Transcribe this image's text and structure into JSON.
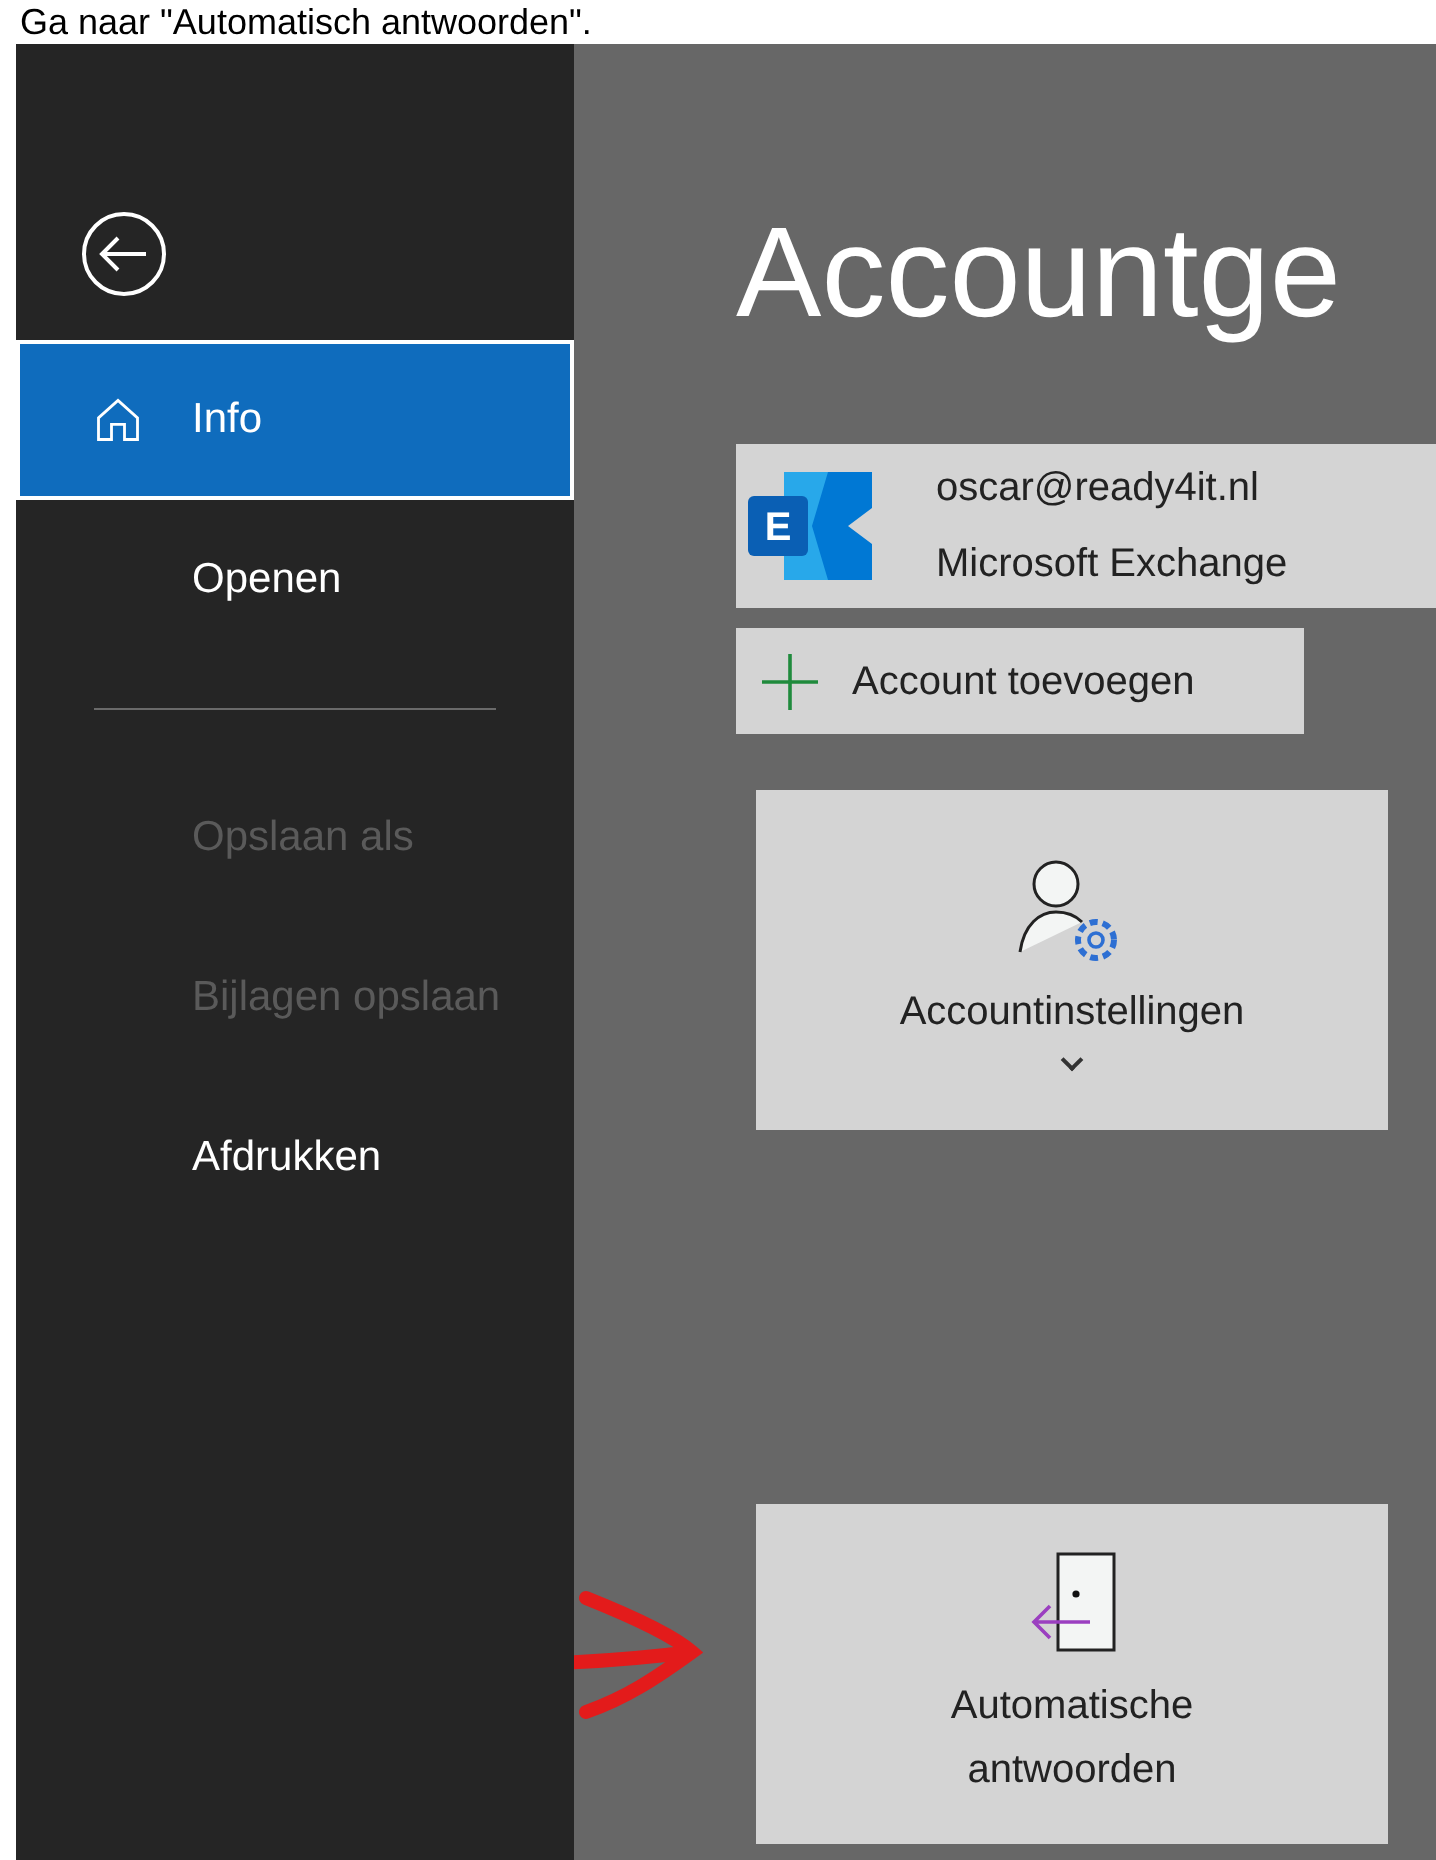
{
  "caption": "Ga naar \"Automatisch antwoorden\".",
  "sidebar": {
    "items": [
      {
        "kind": "home",
        "label": "Info",
        "selected": true,
        "disabled": false
      },
      {
        "kind": "item",
        "label": "Openen",
        "selected": false,
        "disabled": false
      },
      {
        "kind": "divider"
      },
      {
        "kind": "item",
        "label": "Opslaan als",
        "selected": false,
        "disabled": true
      },
      {
        "kind": "item",
        "label": "Bijlagen opslaan",
        "selected": false,
        "disabled": true
      },
      {
        "kind": "item",
        "label": "Afdrukken",
        "selected": false,
        "disabled": false
      }
    ]
  },
  "main": {
    "title": "Accountge",
    "account": {
      "email": "oscar@ready4it.nl",
      "type": "Microsoft Exchange",
      "logo_letter": "E"
    },
    "add_account": "Account toevoegen",
    "tiles": [
      {
        "kind": "settings",
        "label": "Accountinstellingen",
        "dropdown": true
      },
      {
        "kind": "auto_reply",
        "label": "Automatische antwoorden",
        "dropdown": false,
        "annotated": true
      }
    ]
  }
}
